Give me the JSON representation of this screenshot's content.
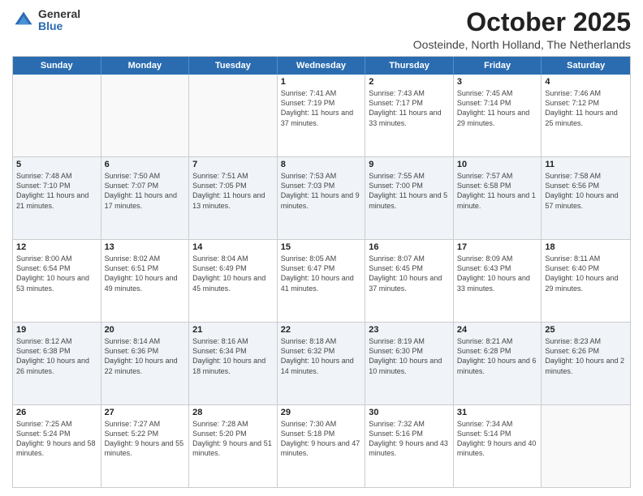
{
  "header": {
    "logo_general": "General",
    "logo_blue": "Blue",
    "month_title": "October 2025",
    "location": "Oosteinde, North Holland, The Netherlands"
  },
  "weekdays": [
    "Sunday",
    "Monday",
    "Tuesday",
    "Wednesday",
    "Thursday",
    "Friday",
    "Saturday"
  ],
  "rows": [
    {
      "shade": false,
      "cells": [
        {
          "day": "",
          "info": ""
        },
        {
          "day": "",
          "info": ""
        },
        {
          "day": "",
          "info": ""
        },
        {
          "day": "1",
          "info": "Sunrise: 7:41 AM\nSunset: 7:19 PM\nDaylight: 11 hours and 37 minutes."
        },
        {
          "day": "2",
          "info": "Sunrise: 7:43 AM\nSunset: 7:17 PM\nDaylight: 11 hours and 33 minutes."
        },
        {
          "day": "3",
          "info": "Sunrise: 7:45 AM\nSunset: 7:14 PM\nDaylight: 11 hours and 29 minutes."
        },
        {
          "day": "4",
          "info": "Sunrise: 7:46 AM\nSunset: 7:12 PM\nDaylight: 11 hours and 25 minutes."
        }
      ]
    },
    {
      "shade": true,
      "cells": [
        {
          "day": "5",
          "info": "Sunrise: 7:48 AM\nSunset: 7:10 PM\nDaylight: 11 hours and 21 minutes."
        },
        {
          "day": "6",
          "info": "Sunrise: 7:50 AM\nSunset: 7:07 PM\nDaylight: 11 hours and 17 minutes."
        },
        {
          "day": "7",
          "info": "Sunrise: 7:51 AM\nSunset: 7:05 PM\nDaylight: 11 hours and 13 minutes."
        },
        {
          "day": "8",
          "info": "Sunrise: 7:53 AM\nSunset: 7:03 PM\nDaylight: 11 hours and 9 minutes."
        },
        {
          "day": "9",
          "info": "Sunrise: 7:55 AM\nSunset: 7:00 PM\nDaylight: 11 hours and 5 minutes."
        },
        {
          "day": "10",
          "info": "Sunrise: 7:57 AM\nSunset: 6:58 PM\nDaylight: 11 hours and 1 minute."
        },
        {
          "day": "11",
          "info": "Sunrise: 7:58 AM\nSunset: 6:56 PM\nDaylight: 10 hours and 57 minutes."
        }
      ]
    },
    {
      "shade": false,
      "cells": [
        {
          "day": "12",
          "info": "Sunrise: 8:00 AM\nSunset: 6:54 PM\nDaylight: 10 hours and 53 minutes."
        },
        {
          "day": "13",
          "info": "Sunrise: 8:02 AM\nSunset: 6:51 PM\nDaylight: 10 hours and 49 minutes."
        },
        {
          "day": "14",
          "info": "Sunrise: 8:04 AM\nSunset: 6:49 PM\nDaylight: 10 hours and 45 minutes."
        },
        {
          "day": "15",
          "info": "Sunrise: 8:05 AM\nSunset: 6:47 PM\nDaylight: 10 hours and 41 minutes."
        },
        {
          "day": "16",
          "info": "Sunrise: 8:07 AM\nSunset: 6:45 PM\nDaylight: 10 hours and 37 minutes."
        },
        {
          "day": "17",
          "info": "Sunrise: 8:09 AM\nSunset: 6:43 PM\nDaylight: 10 hours and 33 minutes."
        },
        {
          "day": "18",
          "info": "Sunrise: 8:11 AM\nSunset: 6:40 PM\nDaylight: 10 hours and 29 minutes."
        }
      ]
    },
    {
      "shade": true,
      "cells": [
        {
          "day": "19",
          "info": "Sunrise: 8:12 AM\nSunset: 6:38 PM\nDaylight: 10 hours and 26 minutes."
        },
        {
          "day": "20",
          "info": "Sunrise: 8:14 AM\nSunset: 6:36 PM\nDaylight: 10 hours and 22 minutes."
        },
        {
          "day": "21",
          "info": "Sunrise: 8:16 AM\nSunset: 6:34 PM\nDaylight: 10 hours and 18 minutes."
        },
        {
          "day": "22",
          "info": "Sunrise: 8:18 AM\nSunset: 6:32 PM\nDaylight: 10 hours and 14 minutes."
        },
        {
          "day": "23",
          "info": "Sunrise: 8:19 AM\nSunset: 6:30 PM\nDaylight: 10 hours and 10 minutes."
        },
        {
          "day": "24",
          "info": "Sunrise: 8:21 AM\nSunset: 6:28 PM\nDaylight: 10 hours and 6 minutes."
        },
        {
          "day": "25",
          "info": "Sunrise: 8:23 AM\nSunset: 6:26 PM\nDaylight: 10 hours and 2 minutes."
        }
      ]
    },
    {
      "shade": false,
      "cells": [
        {
          "day": "26",
          "info": "Sunrise: 7:25 AM\nSunset: 5:24 PM\nDaylight: 9 hours and 58 minutes."
        },
        {
          "day": "27",
          "info": "Sunrise: 7:27 AM\nSunset: 5:22 PM\nDaylight: 9 hours and 55 minutes."
        },
        {
          "day": "28",
          "info": "Sunrise: 7:28 AM\nSunset: 5:20 PM\nDaylight: 9 hours and 51 minutes."
        },
        {
          "day": "29",
          "info": "Sunrise: 7:30 AM\nSunset: 5:18 PM\nDaylight: 9 hours and 47 minutes."
        },
        {
          "day": "30",
          "info": "Sunrise: 7:32 AM\nSunset: 5:16 PM\nDaylight: 9 hours and 43 minutes."
        },
        {
          "day": "31",
          "info": "Sunrise: 7:34 AM\nSunset: 5:14 PM\nDaylight: 9 hours and 40 minutes."
        },
        {
          "day": "",
          "info": ""
        }
      ]
    }
  ]
}
